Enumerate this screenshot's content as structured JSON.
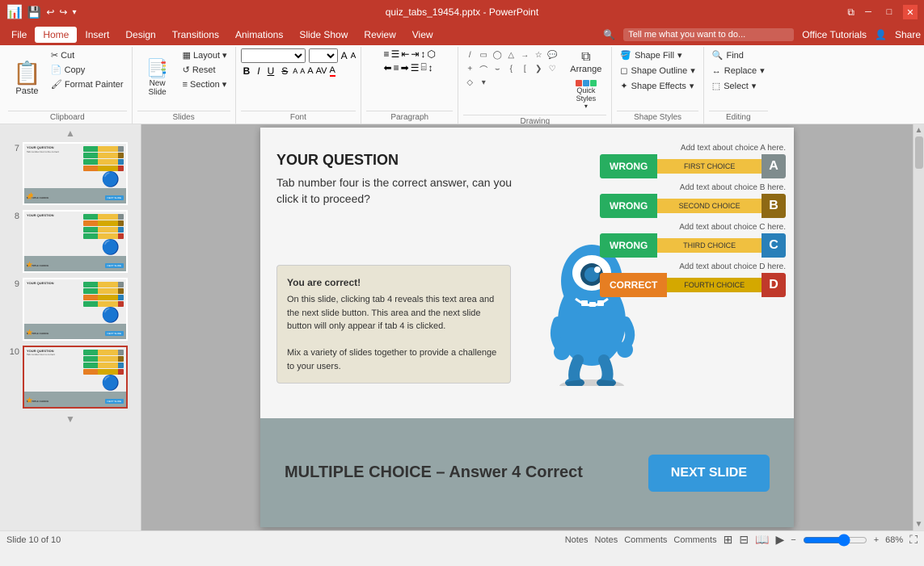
{
  "titlebar": {
    "filename": "quiz_tabs_19454.pptx - PowerPoint",
    "save_icon": "💾",
    "undo_icon": "↩",
    "redo_icon": "↪",
    "minimize": "─",
    "maximize": "□",
    "close": "✕",
    "restore_icon": "⧉"
  },
  "menubar": {
    "items": [
      "File",
      "Home",
      "Insert",
      "Design",
      "Transitions",
      "Animations",
      "Slide Show",
      "Review",
      "View"
    ],
    "active": "Home",
    "search_placeholder": "Tell me what you want to do...",
    "office_tutorials": "Office Tutorials",
    "share": "Share"
  },
  "ribbon": {
    "clipboard_group": "Clipboard",
    "slides_group": "Slides",
    "font_group": "Font",
    "paragraph_group": "Paragraph",
    "drawing_group": "Drawing",
    "editing_group": "Editing",
    "paste_label": "Paste",
    "cut_label": "Cut",
    "copy_label": "Copy",
    "format_painter": "Format Painter",
    "new_slide": "New\nSlide",
    "layout_label": "Layout",
    "reset_label": "Reset",
    "section_label": "Section",
    "shape_fill": "Shape Fill",
    "shape_outline": "Shape Outline",
    "shape_effects": "Shape Effects",
    "arrange": "Arrange",
    "quick_styles": "Quick\nStyles",
    "find": "Find",
    "replace": "Replace",
    "select": "Select"
  },
  "slides": [
    {
      "num": 7,
      "starred": true,
      "active": false
    },
    {
      "num": 8,
      "starred": true,
      "active": false
    },
    {
      "num": 9,
      "starred": true,
      "active": false
    },
    {
      "num": 10,
      "starred": true,
      "active": true
    }
  ],
  "slide": {
    "question_title": "YOUR QUESTION",
    "question_text": "Tab number four is the correct answer, can you click it to proceed?",
    "info_title": "You are correct!",
    "info_body": "On this slide, clicking tab 4 reveals this text area and the next slide button. This area and the next slide button will only appear if tab 4 is clicked.\n\nMix a variety of slides together to provide a challenge to your users.",
    "choices": [
      {
        "status": "WRONG",
        "label": "FIRST CHOICE",
        "letter": "A",
        "detail": "Add text about choice A here."
      },
      {
        "status": "WRONG",
        "label": "SECOND CHOICE",
        "letter": "B",
        "detail": "Add text about choice B here."
      },
      {
        "status": "WRONG",
        "label": "THIRD CHOICE",
        "letter": "C",
        "detail": "Add text about choice C here."
      },
      {
        "status": "CORRECT",
        "label": "FOURTH CHOICE",
        "letter": "D",
        "detail": "Add text about choice D here."
      }
    ],
    "bottom_title": "MULTIPLE CHOICE – Answer 4 Correct",
    "next_slide_btn": "NEXT SLIDE"
  },
  "statusbar": {
    "slide_info": "Slide 10 of 10",
    "notes_label": "Notes",
    "comments_label": "Comments",
    "zoom_level": "68%",
    "zoom_icon": "🔍"
  }
}
